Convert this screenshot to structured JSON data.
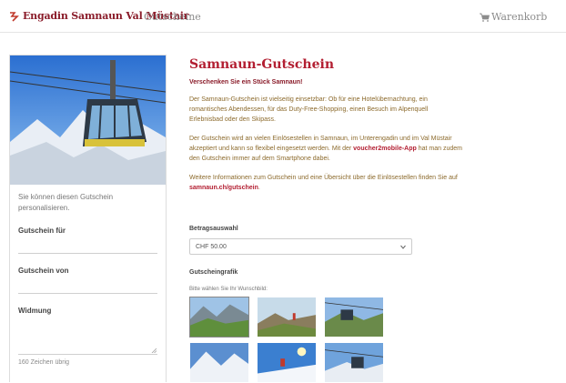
{
  "header": {
    "brand": "Engadin Samnaun Val Müstair",
    "nav_vouchers": "Gutscheine",
    "cart_label": "Warenkorb",
    "brand_color": "#8a1c2a"
  },
  "left": {
    "hero_alt": "Samnaun gondola",
    "personalize_text": "Sie können diesen Gutschein personalisieren.",
    "fields": {
      "for_label": "Gutschein für",
      "from_label": "Gutschein von",
      "dedication_label": "Widmung"
    },
    "chars_left": "160 Zeichen übrig"
  },
  "main": {
    "title": "Samnaun-Gutschein",
    "subtitle": "Verschenken Sie ein Stück Samnaun!",
    "para1": "Der Samnaun-Gutschein ist vielseitig einsetzbar: Ob für eine Hotelübernachtung, ein romantisches Abendessen, für das Duty-Free-Shopping, einen Besuch im Alpenquell Erlebnisbad oder den Skipass.",
    "para2_a": "Der Gutschein wird an vielen Einlösestellen in Samnaun, im Unterengadin und im Val Müstair akzeptiert und kann so flexibel eingesetzt werden. Mit der ",
    "para2_link": "voucher2mobile-App",
    "para2_b": " hat man zudem den Gutschein immer auf dem Smartphone dabei.",
    "para3_a": "Weitere Informationen zum Gutschein und eine Übersicht über die Einlösestellen finden Sie auf ",
    "para3_link": "samnaun.ch/gutschein",
    "para3_b": ".",
    "amount_label": "Betragsauswahl",
    "amount_value": "CHF 50.00",
    "grafik_label": "Gutscheingrafik",
    "grafik_hint": "Bitte wählen Sie Ihr Wunschbild:",
    "accent_color": "#b31f32"
  }
}
